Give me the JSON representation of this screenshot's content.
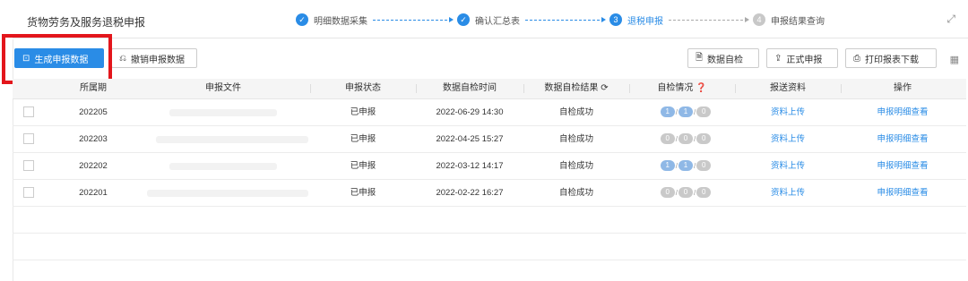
{
  "header": {
    "title": "货物劳务及服务退税申报",
    "steps": [
      {
        "label": "明细数据采集",
        "state": "done",
        "mark": "✓"
      },
      {
        "label": "确认汇总表",
        "state": "done",
        "mark": "✓"
      },
      {
        "label": "退税申报",
        "state": "active",
        "mark": "3"
      },
      {
        "label": "申报结果查询",
        "state": "todo",
        "mark": "4"
      }
    ]
  },
  "toolbar": {
    "generate_label": "生成申报数据",
    "revoke_label": "撤销申报数据",
    "selfcheck_label": "数据自检",
    "formal_label": "正式申报",
    "print_label": "打印报表下载"
  },
  "table": {
    "columns": [
      "所属期",
      "申报文件",
      "申报状态",
      "数据自检时间",
      "数据自检结果",
      "自检情况",
      "报送资料",
      "操作"
    ],
    "rows": [
      {
        "period": "202205",
        "status": "已申报",
        "time": "2022-06-29 14:30",
        "result": "自检成功",
        "c1": "1",
        "c2": "1",
        "c3": "0",
        "material": "资料上传",
        "op": "申报明细查看",
        "active": true
      },
      {
        "period": "202203",
        "status": "已申报",
        "time": "2022-04-25 15:27",
        "result": "自检成功",
        "c1": "0",
        "c2": "0",
        "c3": "0",
        "material": "资料上传",
        "op": "申报明细查看",
        "active": false
      },
      {
        "period": "202202",
        "status": "已申报",
        "time": "2022-03-12 14:17",
        "result": "自检成功",
        "c1": "1",
        "c2": "1",
        "c3": "0",
        "material": "资料上传",
        "op": "申报明细查看",
        "active": true
      },
      {
        "period": "202201",
        "status": "已申报",
        "time": "2022-02-22 16:27",
        "result": "自检成功",
        "c1": "0",
        "c2": "0",
        "c3": "0",
        "material": "资料上传",
        "op": "申报明细查看",
        "active": false
      }
    ]
  },
  "colors": {
    "accent": "#2a8ce6",
    "highlight": "#e3161c"
  }
}
